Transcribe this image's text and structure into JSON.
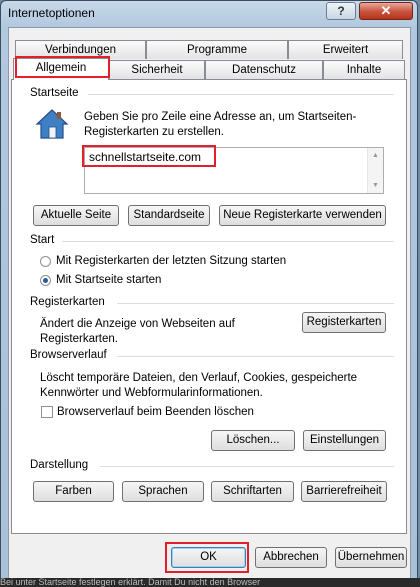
{
  "window": {
    "title": "Internetoptionen",
    "help_label": "?",
    "close_label": "✕"
  },
  "tabs": {
    "row1": [
      "Verbindungen",
      "Programme",
      "Erweitert"
    ],
    "row2": [
      "Allgemein",
      "Sicherheit",
      "Datenschutz",
      "Inhalte"
    ],
    "active": "Allgemein"
  },
  "startseite": {
    "heading": "Startseite",
    "description": "Geben Sie pro Zeile eine Adresse an, um Startseiten-Registerkarten zu erstellen.",
    "url_value": "schnellstartseite.com",
    "buttons": [
      "Aktuelle Seite",
      "Standardseite",
      "Neue Registerkarte verwenden"
    ]
  },
  "start": {
    "heading": "Start",
    "options": [
      {
        "label": "Mit Registerkarten der letzten Sitzung starten",
        "selected": false
      },
      {
        "label": "Mit Startseite starten",
        "selected": true
      }
    ]
  },
  "registerkarten": {
    "heading": "Registerkarten",
    "description": "Ändert die Anzeige von Webseiten auf Registerkarten.",
    "button": "Registerkarten"
  },
  "browserverlauf": {
    "heading": "Browserverlauf",
    "description": "Löscht temporäre Dateien, den Verlauf, Cookies, gespeicherte Kennwörter und Webformularinformationen.",
    "checkbox_label": "Browserverlauf beim Beenden löschen",
    "checkbox_checked": false,
    "delete_button": "Löschen...",
    "settings_button": "Einstellungen"
  },
  "darstellung": {
    "heading": "Darstellung",
    "buttons": [
      "Farben",
      "Sprachen",
      "Schriftarten",
      "Barrierefreiheit"
    ]
  },
  "dialog_buttons": {
    "ok": "OK",
    "cancel": "Abbrechen",
    "apply": "Übernehmen"
  },
  "background_text": "Bei unter Startseite festlegen erklärt. Damit Du nicht den Browser",
  "colors": {
    "highlight_red": "#e0202a",
    "accent_blue": "#2b5a9c"
  }
}
